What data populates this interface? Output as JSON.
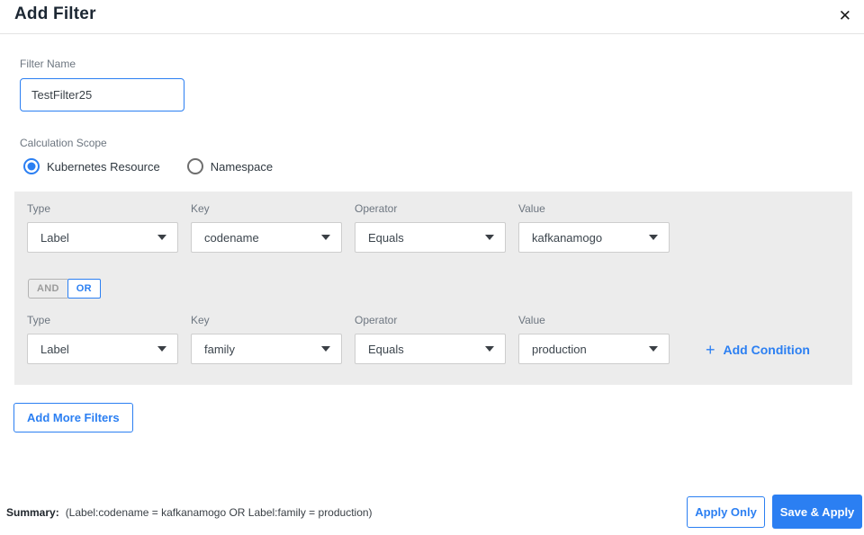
{
  "colors": {
    "accent": "#2b7ff2",
    "panel_bg": "#ececec",
    "title_text": "#1c2733",
    "label_text": "#6d7680"
  },
  "header": {
    "title": "Add Filter",
    "close_icon": "✕"
  },
  "filter_name": {
    "label": "Filter Name",
    "value": "TestFilter25"
  },
  "calculation_scope": {
    "label": "Calculation Scope",
    "options": [
      {
        "label": "Kubernetes Resource",
        "selected": true
      },
      {
        "label": "Namespace",
        "selected": false
      }
    ]
  },
  "conditions": {
    "field_labels": {
      "type": "Type",
      "key": "Key",
      "operator": "Operator",
      "value": "Value"
    },
    "rows": [
      {
        "type": "Label",
        "key": "codename",
        "operator": "Equals",
        "value": "kafkanamogo"
      },
      {
        "type": "Label",
        "key": "family",
        "operator": "Equals",
        "value": "production"
      }
    ],
    "logic_toggle": {
      "and_label": "AND",
      "or_label": "OR",
      "selected": "OR"
    },
    "add_condition": {
      "plus_icon": "+",
      "label": "Add Condition"
    }
  },
  "add_more_filters_label": "Add More Filters",
  "footer": {
    "summary_label": "Summary:",
    "summary_text": "(Label:codename = kafkanamogo OR Label:family = production)",
    "apply_only_label": "Apply Only",
    "save_apply_label": "Save & Apply"
  }
}
